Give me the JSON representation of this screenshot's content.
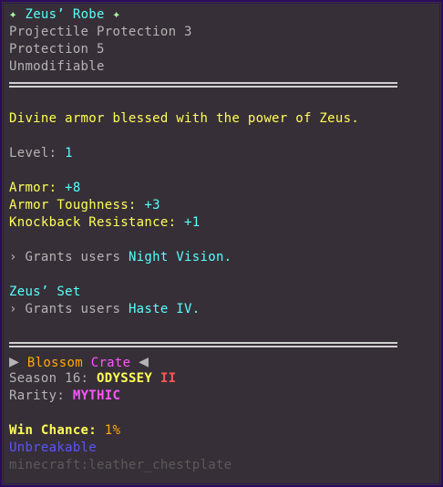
{
  "item": {
    "star_left": "✦",
    "name": "Zeus’ Robe",
    "star_right": "✦",
    "enchant_1": "Projectile Protection 3",
    "enchant_2": "Protection 5",
    "modifiable": "Unmodifiable"
  },
  "description": "Divine armor blessed with the power of Zeus.",
  "level": {
    "label": "Level:",
    "value": "1"
  },
  "stats": [
    {
      "label": "Armor:",
      "value": "+8"
    },
    {
      "label": "Armor Toughness:",
      "value": "+3"
    },
    {
      "label": "Knockback Resistance:",
      "value": "+1"
    }
  ],
  "perk_1": {
    "prefix": "› Grants users",
    "effect": "Night Vision."
  },
  "set": {
    "name": "Zeus’ Set",
    "prefix": "› Grants users",
    "effect": "Haste IV."
  },
  "crate": {
    "arrow_left": "▶",
    "word_1": "Blossom",
    "word_2": "Crate",
    "arrow_right": "◀"
  },
  "season": {
    "label": "Season 16:",
    "name": "ODYSSEY",
    "numeral": "II"
  },
  "rarity": {
    "label": "Rarity:",
    "value": "MYTHIC"
  },
  "win_chance": {
    "label": "Win Chance:",
    "value": "1%"
  },
  "unbreakable": "Unbreakable",
  "item_id": "minecraft:leather_chestplate",
  "colors": {
    "background": "#372f37",
    "border": "#2c0b60",
    "gray": "#b4b4b4",
    "yellow": "#ffff55",
    "aqua": "#55ffff",
    "gold": "#ffaa00",
    "pink": "#ff55ff",
    "red": "#ff5555",
    "blue": "#5555ff",
    "dark_gray": "#5a5a5a",
    "green": "#aaffaa"
  }
}
